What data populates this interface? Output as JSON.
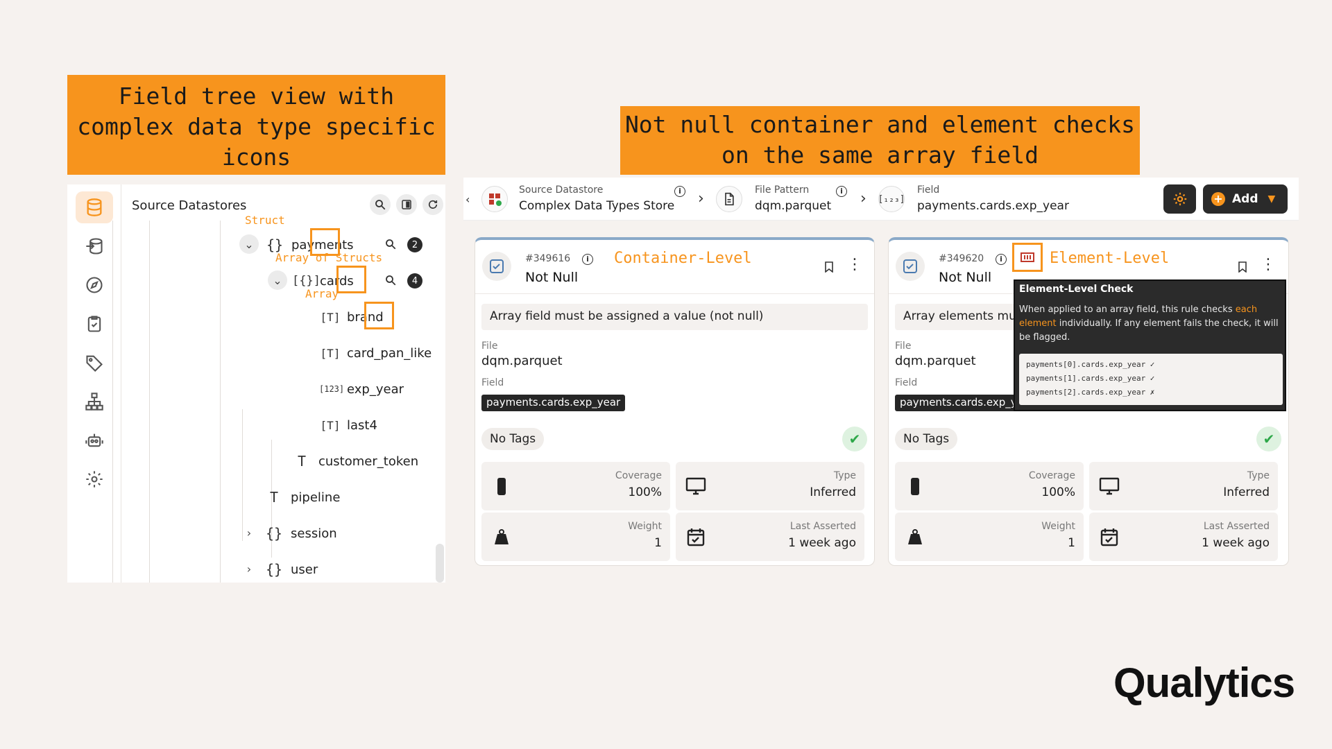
{
  "banners": {
    "left_line1": "Field tree view with",
    "left_line2": "complex data type specific",
    "left_line3": "icons",
    "right_line1": "Not null container and element checks",
    "right_line2": "on the same array field"
  },
  "tree": {
    "title": "Source Datastores",
    "annotations": {
      "struct": "Struct",
      "array_of_structs": "Array of Structs",
      "array": "Array"
    },
    "nodes": [
      {
        "icon": "{}",
        "label": "payments",
        "count": "2"
      },
      {
        "icon": "[{}]",
        "label": "cards",
        "count": "4"
      },
      {
        "icon": "[T]",
        "label": "brand"
      },
      {
        "icon": "[T]",
        "label": "card_pan_like"
      },
      {
        "icon": "[123]",
        "label": "exp_year"
      },
      {
        "icon": "[T]",
        "label": "last4"
      },
      {
        "icon": "T",
        "label": "customer_token"
      },
      {
        "icon": "T",
        "label": "pipeline"
      },
      {
        "icon": "{}",
        "label": "session"
      },
      {
        "icon": "{}",
        "label": "user"
      }
    ]
  },
  "breadcrumb": {
    "datastore_label": "Source Datastore",
    "datastore_value": "Complex Data Types Store",
    "pattern_label": "File Pattern",
    "pattern_value": "dqm.parquet",
    "field_label": "Field",
    "field_value": "payments.cards.exp_year",
    "add_label": "Add"
  },
  "cards": [
    {
      "id": "#349616",
      "name": "Not Null",
      "level": "Container-Level",
      "description": "Array field must be assigned a value (not null)",
      "file_label": "File",
      "file": "dqm.parquet",
      "field_label": "Field",
      "field": "payments.cards.exp_year",
      "tags": "No Tags",
      "coverage_label": "Coverage",
      "coverage": "100%",
      "type_label": "Type",
      "type": "Inferred",
      "weight_label": "Weight",
      "weight": "1",
      "asserted_label": "Last Asserted",
      "asserted": "1 week ago"
    },
    {
      "id": "#349620",
      "name": "Not Null",
      "level": "Element-Level",
      "description": "Array elements mus",
      "file_label": "File",
      "file": "dqm.parquet",
      "field_label": "Field",
      "field": "payments.cards.exp_y",
      "tags": "No Tags",
      "coverage_label": "Coverage",
      "coverage": "100%",
      "type_label": "Type",
      "type": "Inferred",
      "weight_label": "Weight",
      "weight": "1",
      "asserted_label": "Last Asserted",
      "asserted": "1 week ago"
    }
  ],
  "tooltip": {
    "title": "Element-Level Check",
    "body_pre": "When applied to an array field, this rule checks ",
    "body_hl": "each element",
    "body_post": " individually. If any element fails the check, it will be flagged.",
    "code1": "payments[0].cards.exp_year ✓",
    "code2": "payments[1].cards.exp_year ✓",
    "code3": "payments[2].cards.exp_year ✗"
  },
  "logo": "Qualytics",
  "colors": {
    "accent": "#f7941d",
    "dark": "#2a2a2a",
    "success": "#2ea84a"
  }
}
